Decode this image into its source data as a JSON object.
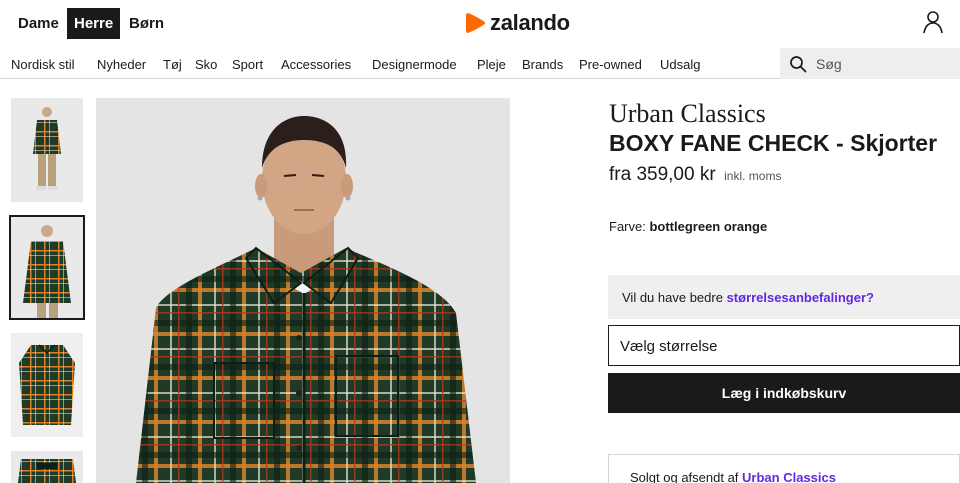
{
  "header": {
    "gender_tabs": [
      {
        "label": "Dame",
        "active": false
      },
      {
        "label": "Herre",
        "active": true
      },
      {
        "label": "Børn",
        "active": false
      }
    ],
    "logo_text": "zalando",
    "logo_color": "#ff6900",
    "user_icon": "user-icon"
  },
  "nav": {
    "items": [
      "Nordisk stil",
      "Nyheder",
      "Tøj",
      "Sko",
      "Sport",
      "Accessories",
      "Designermode",
      "Pleje",
      "Brands",
      "Pre-owned",
      "Udsalg"
    ],
    "search_placeholder": "Søg",
    "search_icon": "search-icon"
  },
  "gallery": {
    "selected_index": 1,
    "thumbnail_count": 4
  },
  "product": {
    "brand": "Urban Classics",
    "name": "BOXY FANE CHECK - Skjorter",
    "price": "fra 359,00 kr",
    "vat_note": "inkl. moms",
    "color_label": "Farve:",
    "color_value": "bottlegreen orange"
  },
  "size_recommendation": {
    "text": "Vil du have bedre ",
    "link": "størrelsesanbefalinger?"
  },
  "size_select": {
    "placeholder": "Vælg størrelse"
  },
  "cart_button": {
    "label": "Læg i indkøbskurv"
  },
  "seller": {
    "text": "Solgt og afsendt af ",
    "link": "Urban Classics"
  },
  "colors": {
    "accent_link": "#6328e0",
    "primary_dark": "#1a1a1a",
    "shirt_green": "#1f3a26",
    "shirt_orange": "#d9822b"
  }
}
